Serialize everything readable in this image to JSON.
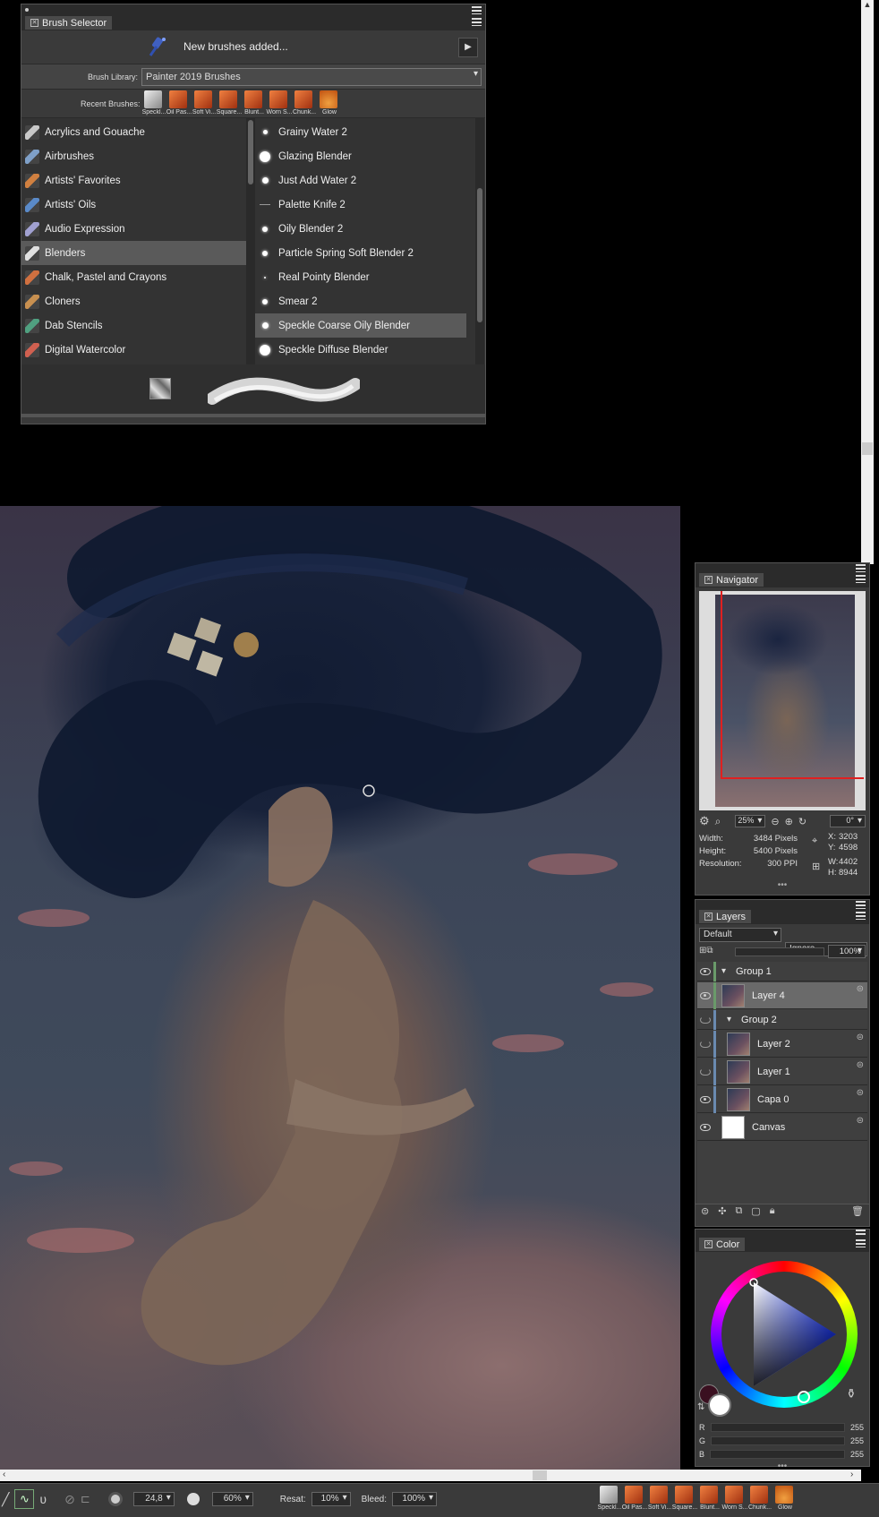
{
  "brush_selector": {
    "title": "Brush Selector",
    "notice": "New brushes added...",
    "library_label": "Brush Library:",
    "library_value": "Painter 2019 Brushes",
    "recent_label": "Recent Brushes:",
    "recent": [
      "Speckl...",
      "Oil Pas...",
      "Soft Vi...",
      "Square...",
      "Blunt...",
      "Worn S...",
      "Chunk...",
      "Glow"
    ],
    "categories": [
      {
        "label": "Acrylics and Gouache",
        "color": "#c8c8c8"
      },
      {
        "label": "Airbrushes",
        "color": "#7fa0c8"
      },
      {
        "label": "Artists' Favorites",
        "color": "#d08040"
      },
      {
        "label": "Artists' Oils",
        "color": "#5a8ac8"
      },
      {
        "label": "Audio Expression",
        "color": "#a0a0d0"
      },
      {
        "label": "Blenders",
        "color": "#e0e0e0"
      },
      {
        "label": "Chalk, Pastel and Crayons",
        "color": "#d07040"
      },
      {
        "label": "Cloners",
        "color": "#c89050"
      },
      {
        "label": "Dab Stencils",
        "color": "#50a080"
      },
      {
        "label": "Digital Watercolor",
        "color": "#d06050"
      }
    ],
    "selected_category": "Blenders",
    "variants": [
      {
        "label": "Grainy Water 2",
        "dot": 5
      },
      {
        "label": "Glazing Blender",
        "dot": 12
      },
      {
        "label": "Just Add Water 2",
        "dot": 7
      },
      {
        "label": "Palette Knife 2",
        "dot": 0
      },
      {
        "label": "Oily Blender 2",
        "dot": 6
      },
      {
        "label": "Particle Spring Soft Blender 2",
        "dot": 6
      },
      {
        "label": "Real Pointy Blender",
        "dot": 2
      },
      {
        "label": "Smear 2",
        "dot": 6
      },
      {
        "label": "Speckle Coarse Oily Blender",
        "dot": 7
      },
      {
        "label": "Speckle Diffuse Blender",
        "dot": 12
      }
    ],
    "selected_variant": "Speckle Coarse Oily Blender"
  },
  "navigator": {
    "title": "Navigator",
    "zoom": "25%",
    "rotation": "0°",
    "width_label": "Width:",
    "width_value": "3484 Pixels",
    "height_label": "Height:",
    "height_value": "5400 Pixels",
    "resolution_label": "Resolution:",
    "resolution_value": "300 PPI",
    "x_label": "X:",
    "x_value": "3203",
    "y_label": "Y:",
    "y_value": "4598",
    "w_label": "W:",
    "w_value": "4402",
    "h_label": "H:",
    "h_value": "8944"
  },
  "layers": {
    "title": "Layers",
    "composite_method": "Default",
    "preserve": "Ignore",
    "opacity": "100%",
    "items": [
      {
        "label": "Group 1",
        "type": "group",
        "visible": true,
        "selected": false
      },
      {
        "label": "Layer 4",
        "type": "layer",
        "visible": true,
        "selected": true
      },
      {
        "label": "Group 2",
        "type": "group",
        "visible": false,
        "selected": false
      },
      {
        "label": "Layer 2",
        "type": "layer",
        "visible": false,
        "selected": false
      },
      {
        "label": "Layer 1",
        "type": "layer",
        "visible": false,
        "selected": false
      },
      {
        "label": "Capa 0",
        "type": "layer",
        "visible": true,
        "selected": false
      },
      {
        "label": "Canvas",
        "type": "canvas",
        "visible": true,
        "selected": false
      }
    ]
  },
  "color": {
    "title": "Color",
    "r_label": "R",
    "r": "255",
    "g_label": "G",
    "g": "255",
    "b_label": "B",
    "b": "255"
  },
  "property_bar": {
    "size": "24,8",
    "opacity": "60%",
    "resat_label": "Resat:",
    "resat": "10%",
    "bleed_label": "Bleed:",
    "bleed": "100%",
    "recent": [
      "Speckl...",
      "Oil Pas...",
      "Soft Vi...",
      "Square...",
      "Blunt...",
      "Worn S...",
      "Chunk...",
      "Glow"
    ]
  },
  "colors": {
    "panel_bg": "#3a3a3a",
    "selection": "#5a5a5a",
    "accent_red": "#e02020"
  }
}
